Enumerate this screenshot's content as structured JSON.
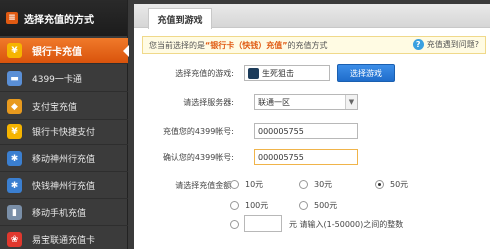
{
  "sidebar": {
    "title": "选择充值的方式",
    "items": [
      {
        "label": "银行卡充值",
        "icon": "yen-icon",
        "glyph": "¥",
        "color": "#f6b400",
        "active": true
      },
      {
        "label": "4399一卡通",
        "icon": "card-icon",
        "glyph": "▬",
        "color": "#5a8fd6",
        "active": false
      },
      {
        "label": "支付宝充值",
        "icon": "alipay-shield-icon",
        "glyph": "◆",
        "color": "#e89a1e",
        "active": false
      },
      {
        "label": "银行卡快捷支付",
        "icon": "yen-icon",
        "glyph": "¥",
        "color": "#f6b400",
        "active": false
      },
      {
        "label": "移动神州行充值",
        "icon": "mobile-logo-icon",
        "glyph": "✱",
        "color": "#3b7fd0",
        "active": false
      },
      {
        "label": "快钱神州行充值",
        "icon": "mobile-logo-icon",
        "glyph": "✱",
        "color": "#3b7fd0",
        "active": false
      },
      {
        "label": "移动手机充值",
        "icon": "phone-icon",
        "glyph": "▮",
        "color": "#7a8fa8",
        "active": false
      },
      {
        "label": "易宝联通充值卡",
        "icon": "unicom-icon",
        "glyph": "❀",
        "color": "#e0382e",
        "active": false
      }
    ]
  },
  "tab": {
    "label": "充值到游戏"
  },
  "notice": {
    "prefix": "您当前选择的是",
    "method": "“银行卡（快钱）充值”",
    "suffix": "的充值方式",
    "help_label": "充值遇到问题?"
  },
  "form": {
    "game_label": "选择充值的游戏:",
    "game_value": "生死狙击",
    "select_game_button": "选择游戏",
    "server_label": "请选择服务器:",
    "server_value": "联通一区",
    "account_label": "充值您的4399帐号:",
    "account_value": "000005755",
    "confirm_label": "确认您的4399帐号:",
    "confirm_value": "000005755",
    "amount_label": "请选择充值金额:",
    "amounts": [
      "10元",
      "30元",
      "50元",
      "100元",
      "500元"
    ],
    "selected_amount": "50元",
    "custom_hint": "元 请输入(1-50000)之间的整数"
  }
}
